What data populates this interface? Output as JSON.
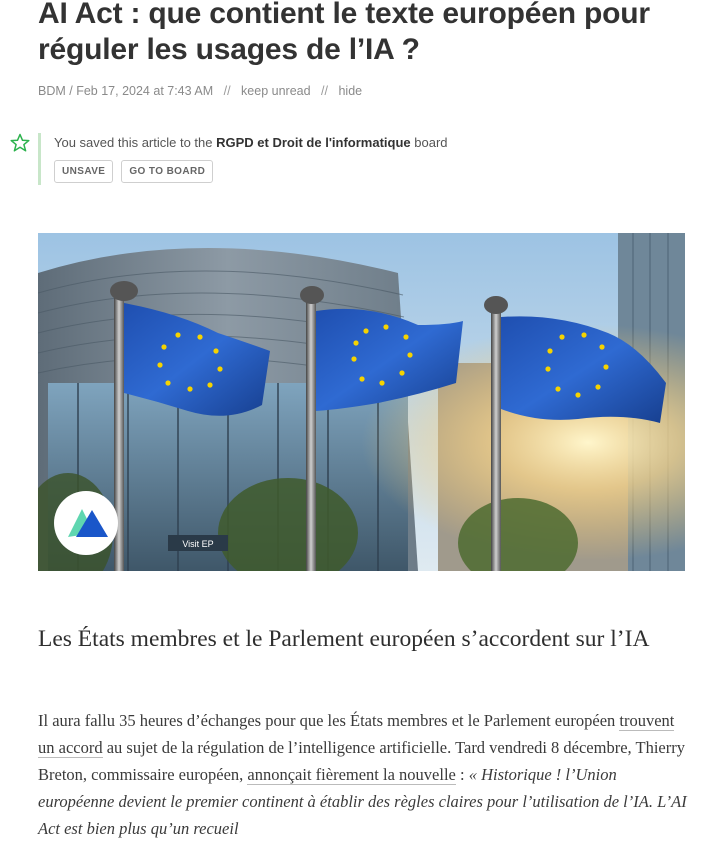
{
  "article": {
    "title": "AI Act : que contient le texte européen pour réguler les usages de l’IA ?",
    "meta": {
      "source": "BDM",
      "date": "Feb 17, 2024 at 7:43 AM",
      "separator": "//",
      "keep_unread": "keep unread",
      "hide": "hide"
    },
    "saved": {
      "prefix": "You saved this article to the",
      "board": "RGPD et Droit de l'informatique",
      "suffix": "board",
      "unsave_label": "UNSAVE",
      "go_to_board_label": "GO TO BOARD"
    },
    "hero": {
      "sign_text": "Visit EP"
    },
    "heading": "Les États membres et le Parlement européen s’accordent sur l’IA",
    "paragraph": {
      "t1": "Il aura fallu 35 heures d’échanges pour que les États membres et le Parlement européen ",
      "link1": "trouvent un accord",
      "t2": " au sujet de la régulation de l’intelligence artificielle. Tard vendredi 8 décembre, Thierry Breton, commissaire européen, ",
      "link2": "annonçait fièrement la nouvelle",
      "t3": " : ",
      "quote": "« Historique ! l’Union européenne devient le premier continent à établir des règles claires pour l’utilisation de l’IA. L’AI Act est bien plus qu’un recueil"
    }
  },
  "colors": {
    "saved_bar": "#c8e6c9",
    "star": "#2bb24c",
    "logo_blue": "#1a56c9",
    "logo_mint": "#5fd6b0"
  }
}
